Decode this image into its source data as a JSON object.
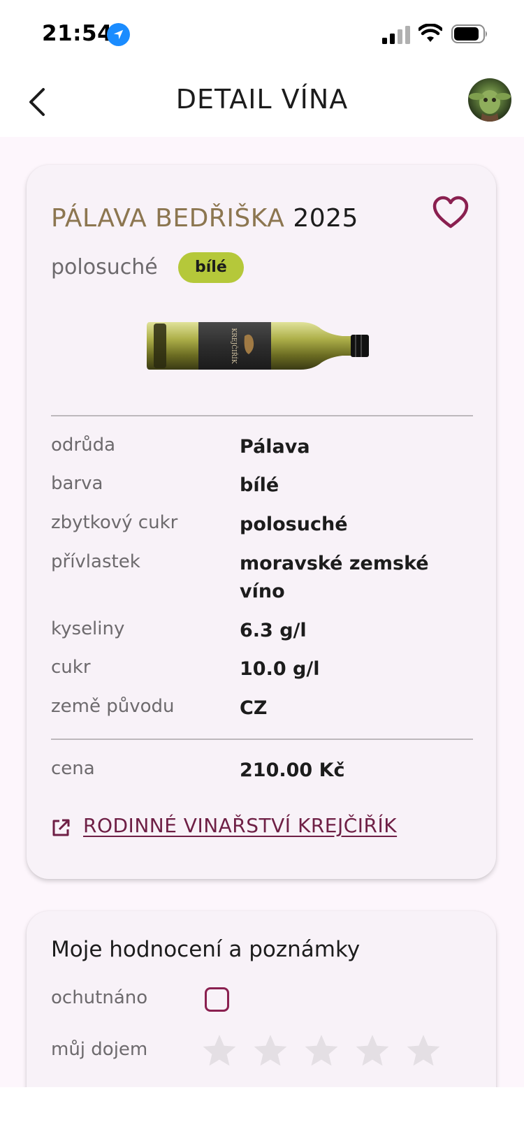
{
  "status_bar": {
    "time": "21:54",
    "icons": [
      "location-arrow-icon",
      "cellular-signal-icon",
      "wifi-icon",
      "battery-icon"
    ]
  },
  "header": {
    "title": "DETAIL VÍNA",
    "back_icon": "chevron-left-icon",
    "avatar": "user-avatar"
  },
  "wine": {
    "name": "PÁLAVA BEDŘIŠKA",
    "year": "2025",
    "sweetness": "polosuché",
    "color_badge": "bílé",
    "favorite_icon": "heart-outline-icon",
    "bottle_label": "KREJČIŘÍK",
    "details": [
      {
        "label": "odrůda",
        "value": "Pálava"
      },
      {
        "label": "barva",
        "value": "bílé"
      },
      {
        "label": "zbytkový cukr",
        "value": "polosuché"
      },
      {
        "label": "přívlastek",
        "value": "moravské zemské víno"
      },
      {
        "label": "kyseliny",
        "value": "6.3 g/l"
      },
      {
        "label": "cukr",
        "value": "10.0 g/l"
      },
      {
        "label": "země původu",
        "value": "CZ"
      }
    ],
    "price": {
      "label": "cena",
      "value": "210.00 Kč"
    },
    "winery_link": "RODINNÉ VINAŘSTVÍ KREJČIŘÍK"
  },
  "notes": {
    "title": "Moje hodnocení a poznámky",
    "tasted_label": "ochutnáno",
    "tasted": false,
    "impression_label": "můj dojem",
    "rating": 0,
    "rating_max": 5
  },
  "colors": {
    "accent": "#8a2050",
    "name_gold": "#8c7650",
    "badge_green": "#b5c83a",
    "link": "#6e1f45",
    "background": "#fdf6fc"
  }
}
